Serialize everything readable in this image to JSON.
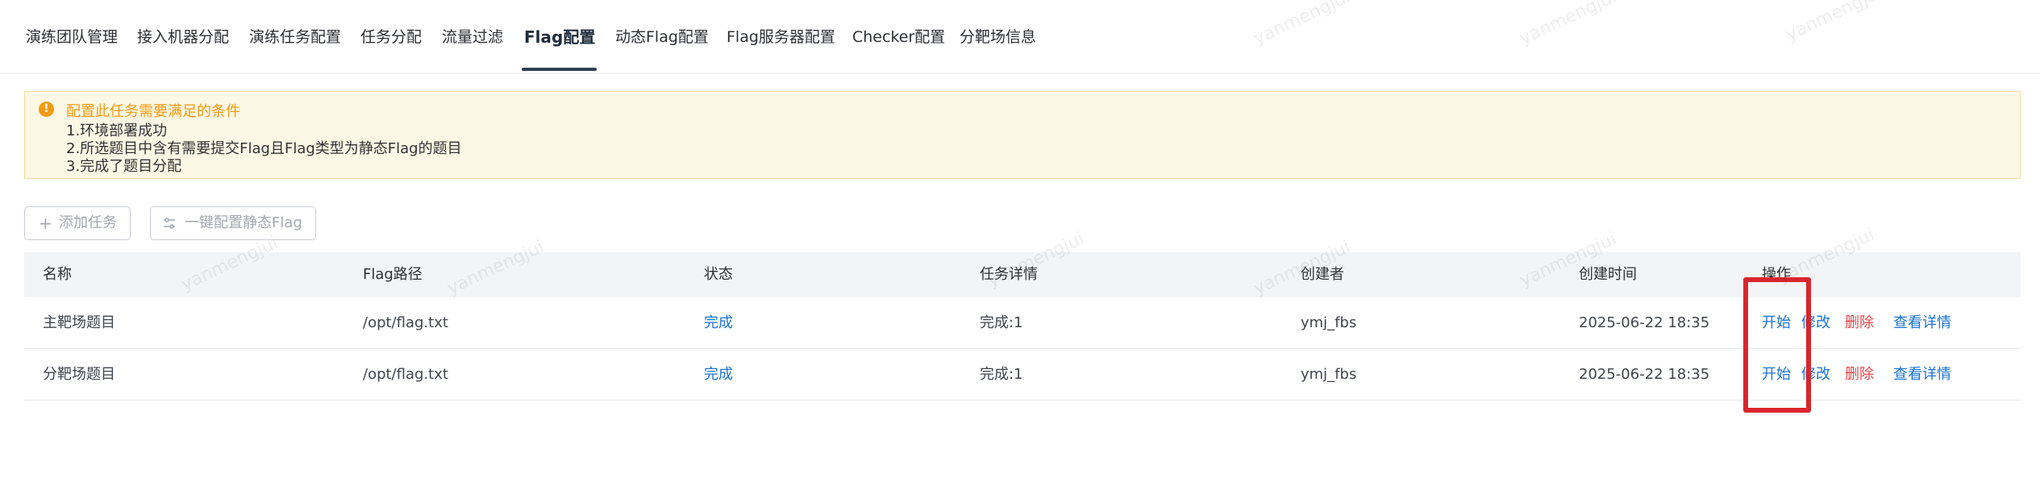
{
  "tabs": [
    {
      "label": "演练团队管理"
    },
    {
      "label": "接入机器分配"
    },
    {
      "label": "演练任务配置"
    },
    {
      "label": "任务分配"
    },
    {
      "label": "流量过滤"
    },
    {
      "label": "Flag配置",
      "active": true
    },
    {
      "label": "动态Flag配置"
    },
    {
      "label": "Flag服务器配置"
    },
    {
      "label": "Checker配置"
    },
    {
      "label": "分靶场信息"
    }
  ],
  "alert": {
    "title": "配置此任务需要满足的条件",
    "lines": [
      "1.环境部署成功",
      "2.所选题目中含有需要提交Flag且Flag类型为静态Flag的题目",
      "3.完成了题目分配"
    ],
    "icon": "warning-icon"
  },
  "toolbar": {
    "add_task": "添加任务",
    "one_click_config": "一键配置静态Flag"
  },
  "table": {
    "columns": [
      "名称",
      "Flag路径",
      "状态",
      "任务详情",
      "创建者",
      "创建时间",
      "操作"
    ],
    "rows": [
      {
        "name": "主靶场题目",
        "flag_path": "/opt/flag.txt",
        "status": "完成",
        "detail": "完成:1",
        "creator": "ymj_fbs",
        "created_at": "2025-06-22 18:35",
        "actions": [
          "开始",
          "修改",
          "删除",
          "查看详情"
        ]
      },
      {
        "name": "分靶场题目",
        "flag_path": "/opt/flag.txt",
        "status": "完成",
        "detail": "完成:1",
        "creator": "ymj_fbs",
        "created_at": "2025-06-22 18:35",
        "actions": [
          "开始",
          "修改",
          "删除",
          "查看详情"
        ]
      }
    ]
  },
  "watermark": "yanmengjui",
  "colors": {
    "accent_blue": "#1a73d6",
    "danger_red": "#e5484d",
    "warning_orange": "#f39c12",
    "highlight_red": "#d9262c"
  }
}
